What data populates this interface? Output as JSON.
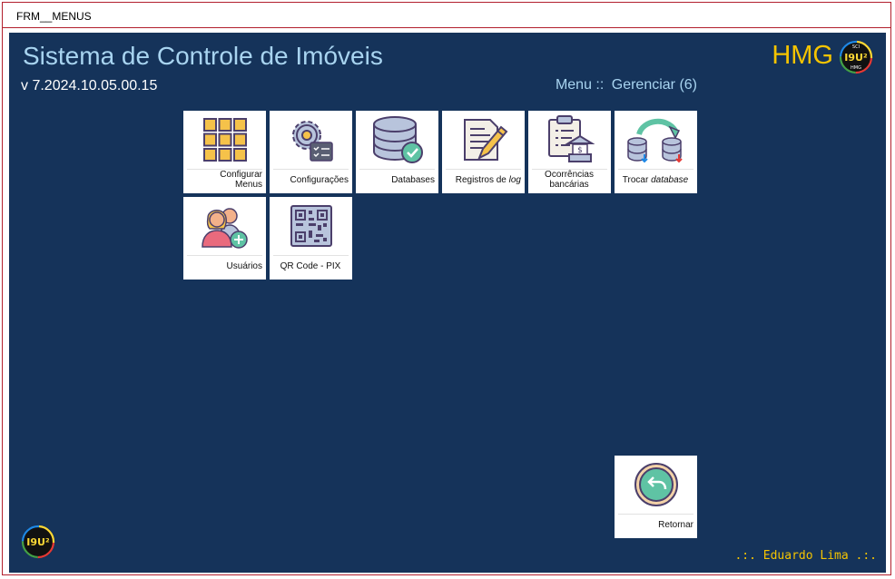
{
  "window": {
    "title": "FRM__MENUS"
  },
  "header": {
    "app_title": "Sistema de Controle de Imóveis",
    "version": "v 7.2024.10.05.00.15",
    "breadcrumb_prefix": "Menu ::",
    "breadcrumb_current": "Gerenciar (6)",
    "environment": "HMG",
    "logo_text": "I9U²",
    "logo_small_top": "SCI",
    "logo_small_bottom": "HMG"
  },
  "tiles": [
    {
      "id": "configurar-menus",
      "label_line1": "Configurar",
      "label_line2": "Menus",
      "icon": "grid-icon"
    },
    {
      "id": "configuracoes",
      "label": "Configurações",
      "icon": "settings-gear-icon"
    },
    {
      "id": "databases",
      "label": "Databases",
      "icon": "database-check-icon"
    },
    {
      "id": "registros-log",
      "label_prefix": "Registros de ",
      "label_em": "log",
      "icon": "document-pencil-icon"
    },
    {
      "id": "ocorrencias-bancarias",
      "label_line1": "Ocorrências",
      "label_line2": "bancárias",
      "icon": "clipboard-bank-icon"
    },
    {
      "id": "trocar-database",
      "label_prefix": "Trocar ",
      "label_em": "database",
      "icon": "swap-database-icon"
    },
    {
      "id": "usuarios",
      "label": "Usuários",
      "icon": "add-user-icon"
    },
    {
      "id": "qr-code-pix",
      "label": "QR Code - PIX",
      "icon": "qr-code-icon"
    },
    {
      "id": "retornar",
      "label": "Retornar",
      "icon": "return-arrow-icon"
    }
  ],
  "footer": {
    "user": ".:. Eduardo Lima .:.",
    "logo_text": "I9U²"
  },
  "colors": {
    "background": "#15335a",
    "title": "#a8d4f0",
    "accent_yellow": "#f5c400",
    "border_red": "#b21f2d"
  }
}
